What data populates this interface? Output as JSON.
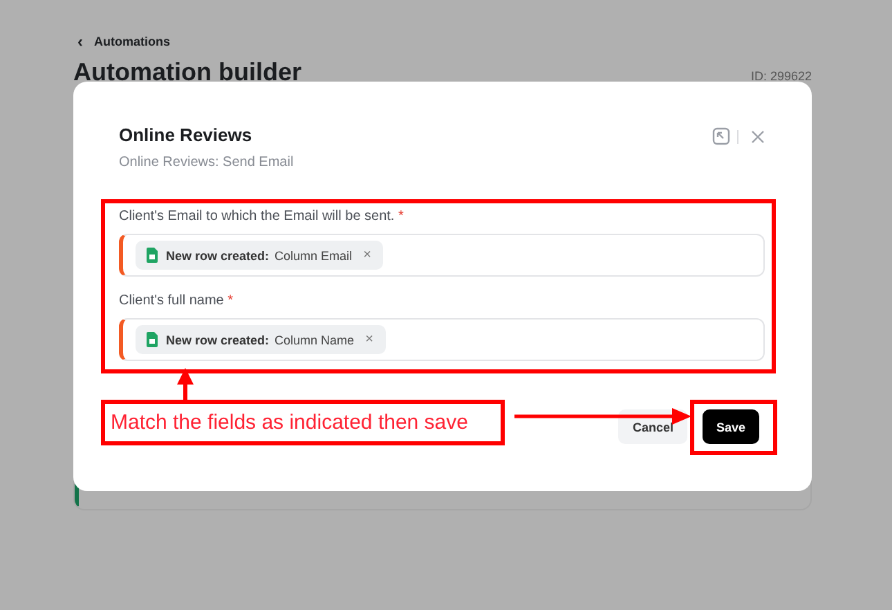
{
  "page": {
    "back_icon": "‹",
    "back_link": "Automations",
    "title": "Automation builder",
    "id": "ID: 299622"
  },
  "modal": {
    "title": "Online Reviews",
    "subtitle": "Online Reviews: Send Email",
    "fields": [
      {
        "label": "Client's Email to which the Email will be sent.",
        "required_mark": "*",
        "chip": {
          "source": "New row created:",
          "value": "Column Email",
          "remove": "×"
        }
      },
      {
        "label": "Client's full name",
        "required_mark": "*",
        "chip": {
          "source": "New row created:",
          "value": "Column Name",
          "remove": "×"
        }
      }
    ],
    "buttons": [
      {
        "kind": "secondary",
        "label": "Cancel"
      },
      {
        "kind": "primary",
        "label": "Save"
      }
    ]
  },
  "annotation": {
    "callout": "Match the fields as indicated then save"
  }
}
